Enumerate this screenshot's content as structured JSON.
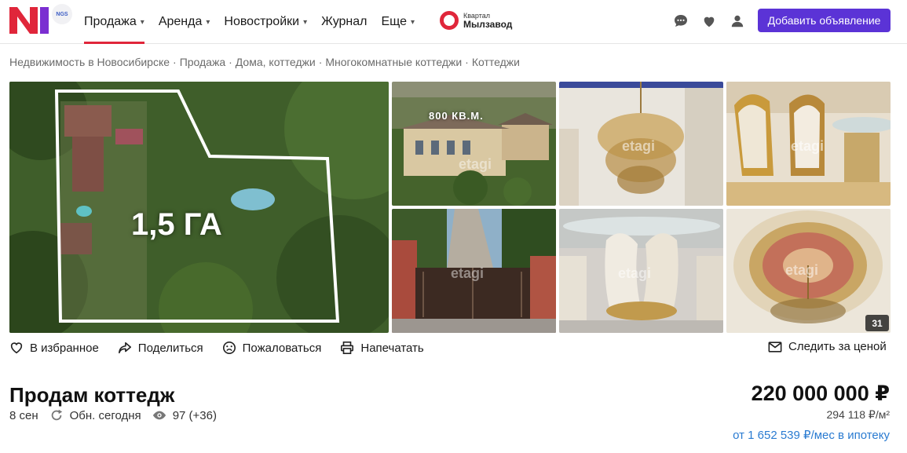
{
  "header": {
    "logo_text": "N1",
    "ngs_text": "NGS",
    "nav": [
      {
        "label": "Продажа",
        "dropdown": true,
        "active": true
      },
      {
        "label": "Аренда",
        "dropdown": true
      },
      {
        "label": "Новостройки",
        "dropdown": true
      },
      {
        "label": "Журнал",
        "dropdown": false
      },
      {
        "label": "Еще",
        "dropdown": true
      }
    ],
    "kvartal_small": "Квартал",
    "kvartal_big": "Мылзавод",
    "add_button": "Добавить объявление"
  },
  "breadcrumb": [
    "Недвижимость в Новосибирске",
    "Продажа",
    "Дома, коттеджи",
    "Многокомнатные коттеджи",
    "Коттеджи"
  ],
  "breadcrumb_sep": "·",
  "gallery": {
    "main_caption": "1,5 ГА",
    "thumb1_caption": "800 КВ.М.",
    "watermark": "etagi",
    "photo_count": "31"
  },
  "actions": {
    "favorite": "В избранное",
    "share": "Поделиться",
    "complain": "Пожаловаться",
    "print": "Напечатать",
    "watch_price": "Следить за ценой"
  },
  "listing": {
    "title": "Продам коттедж",
    "date": "8 сен",
    "updated": "Обн. сегодня",
    "views": "97 (+36)",
    "price": "220 000 000 ₽",
    "price_per_m2": "294 118 ₽/м²",
    "mortgage": "от 1 652 539 ₽/мес в ипотеку"
  },
  "colors": {
    "brand_red": "#e0263a",
    "button_purple": "#5b33d6",
    "link_blue": "#2a7bd1"
  }
}
